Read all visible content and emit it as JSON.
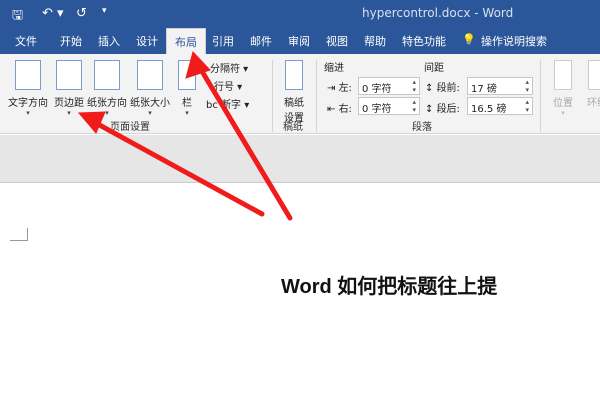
{
  "title_bar": {
    "title": "hypercontrol.docx  -  Word",
    "save_icon": "save-icon",
    "undo_icon": "undo-icon",
    "redo_icon": "redo-icon",
    "customize_icon": "dropdown-icon"
  },
  "tabs": [
    "文件",
    "开始",
    "插入",
    "设计",
    "布局",
    "引用",
    "邮件",
    "审阅",
    "视图",
    "帮助",
    "特色功能"
  ],
  "active_tab": "布局",
  "tell_me": "操作说明搜索",
  "page_setup": {
    "text_direction": "文字方向",
    "margins": "页边距",
    "orientation": "纸张方向",
    "size": "纸张大小",
    "columns": "栏",
    "breaks": "分隔符",
    "line_numbers": "行号",
    "hyphenation": "断字",
    "group": "页面设置"
  },
  "manuscript": {
    "label1": "稿纸",
    "label2": "设置",
    "group": "稿纸"
  },
  "paragraph": {
    "indent": "缩进",
    "spacing": "间距",
    "left_label": "左:",
    "left_value": "0 字符",
    "right_label": "右:",
    "right_value": "0 字符",
    "before_label": "段前:",
    "before_value": "17 磅",
    "after_label": "段后:",
    "after_value": "16.5 磅",
    "group": "段落"
  },
  "arrange": {
    "position": "位置",
    "wrap": "环绕"
  },
  "document": {
    "heading": "Word  如何把标题往上提"
  },
  "colors": {
    "title_bar": "#2b579a",
    "arrow": "#f01c1c"
  }
}
